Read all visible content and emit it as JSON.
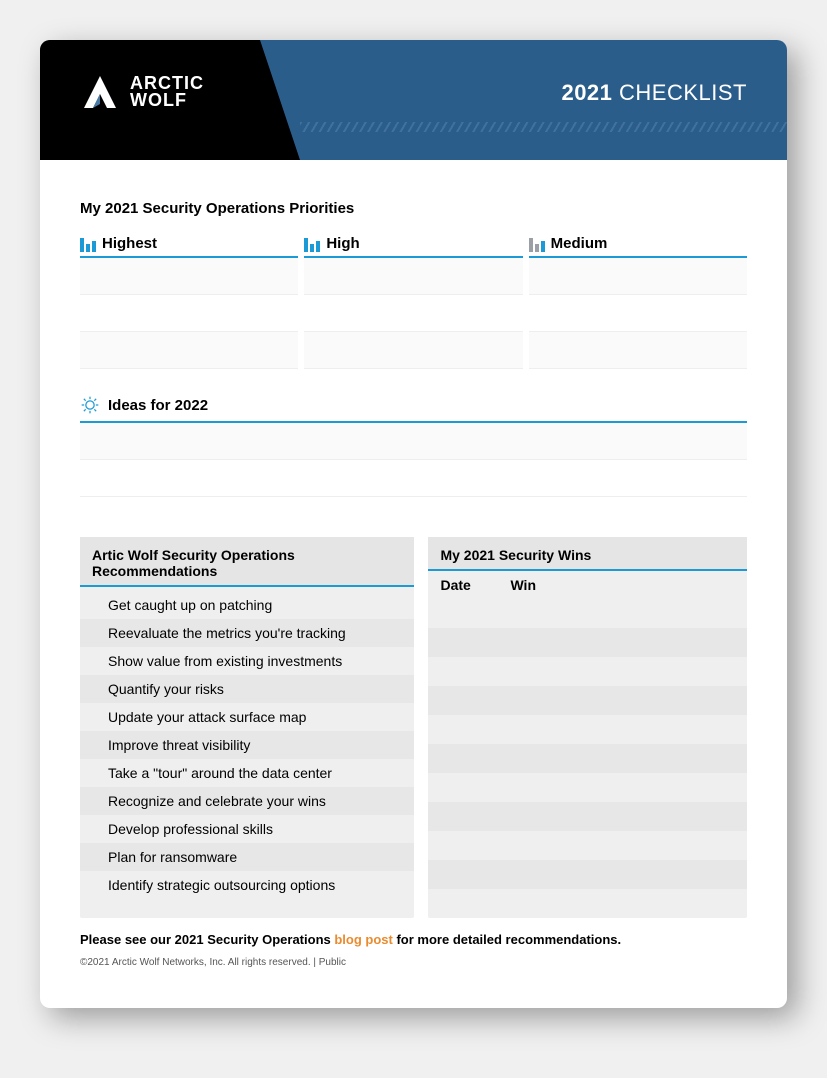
{
  "header": {
    "brand_line1": "ARCTIC",
    "brand_line2": "WOLF",
    "year": "2021",
    "title_rest": " CHECKLIST"
  },
  "priorities": {
    "section_title": "My 2021 Security Operations Priorities",
    "cols": [
      "Highest",
      "High",
      "Medium"
    ]
  },
  "ideas": {
    "title": "Ideas for 2022"
  },
  "recs": {
    "title": "Artic Wolf Security Operations Recommendations",
    "items": [
      "Get caught up on patching",
      "Reevaluate the metrics you're tracking",
      "Show value from existing investments",
      "Quantify your risks",
      "Update your attack surface map",
      "Improve threat visibility",
      "Take a \"tour\" around the data center",
      "Recognize and celebrate your wins",
      "Develop professional skills",
      "Plan for ransomware",
      "Identify strategic outsourcing options"
    ]
  },
  "wins": {
    "title": "My 2021 Security Wins",
    "col_date": "Date",
    "col_win": "Win"
  },
  "footer": {
    "pre": "Please see our 2021 Security Operations ",
    "link": "blog post",
    "post": " for more detailed recommendations."
  },
  "copyright": "©2021 Arctic Wolf Networks, Inc. All rights reserved.  |  Public"
}
